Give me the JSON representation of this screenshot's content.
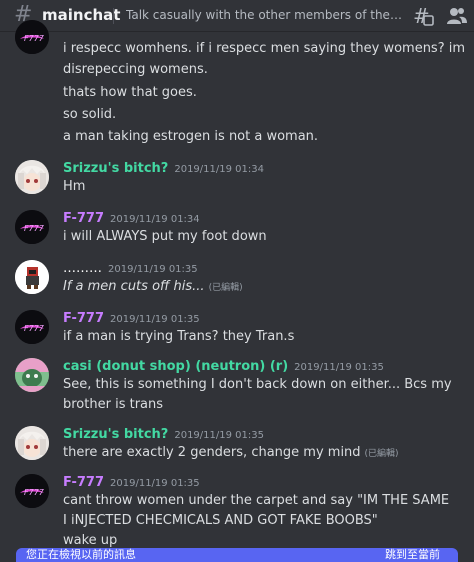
{
  "header": {
    "channel_name": "mainchat",
    "topic": "Talk casually with the other members of the server...",
    "icons": [
      "hashtag-icon",
      "threads-icon",
      "members-icon"
    ]
  },
  "colors": {
    "f777": "#c77dff",
    "srizzu": "#43d9a3",
    "dots": "#ffffff",
    "casi": "#43d9a3",
    "jump_bar": "#5865f2"
  },
  "messages": [
    {
      "lines": [
        "i respecc womhens. if i respecc men saying they womens? im",
        "disrepeccing womens.",
        "thats how that goes.",
        "so solid.",
        "a man taking estrogen is not a woman."
      ]
    },
    {
      "username": "Srizzu's bitch?",
      "timestamp": "2019/11/19 01:34",
      "lines": [
        "Hm"
      ]
    },
    {
      "username": "F-777",
      "timestamp": "2019/11/19 01:34",
      "lines": [
        "i will ALWAYS put my foot down"
      ]
    },
    {
      "username": "………",
      "timestamp": "2019/11/19 01:35",
      "lines": [
        "If a men cuts off his..."
      ],
      "edited": "(已編輯)"
    },
    {
      "username": "F-777",
      "timestamp": "2019/11/19 01:35",
      "lines": [
        "if a man is trying Trans? they Tran.s"
      ]
    },
    {
      "username": "casi (donut shop) (neutron) (r)",
      "timestamp": "2019/11/19 01:35",
      "lines": [
        "See, this is something I don't back down on either... Bcs my",
        "brother is trans"
      ]
    },
    {
      "username": "Srizzu's bitch?",
      "timestamp": "2019/11/19 01:35",
      "lines": [
        "there are exactly 2 genders, change my mind"
      ],
      "edited": "(已編輯)"
    },
    {
      "username": "F-777",
      "timestamp": "2019/11/19 01:35",
      "lines": [
        "cant throw women under the carpet and say \"IM THE SAME",
        "I iNJECTED CHECMICALS AND GOT FAKE BOOBS\"",
        "wake up"
      ]
    }
  ],
  "jump_bar": {
    "left_text": "您正在檢視以前的訊息",
    "right_text": "跳到至當前"
  }
}
